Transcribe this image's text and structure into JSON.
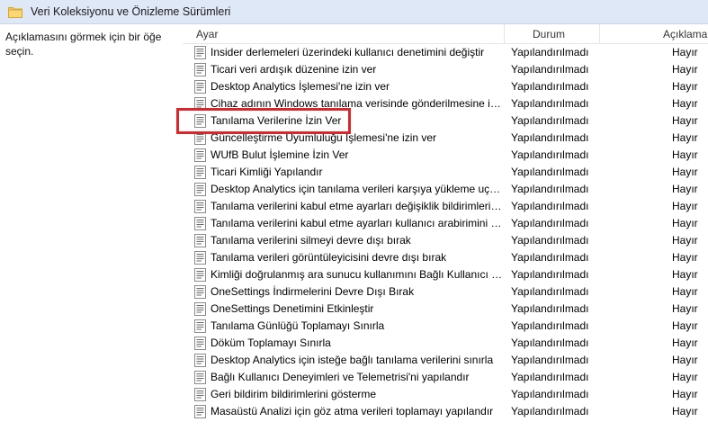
{
  "window": {
    "title": "Veri Koleksiyonu ve Önizleme Sürümleri"
  },
  "description_pane": {
    "text": "Açıklamasını görmek için bir öğe seçin."
  },
  "columns": {
    "name": "Ayar",
    "state": "Durum",
    "comment": "Açıklama"
  },
  "icons": {
    "folder": "folder-icon",
    "policy": "policy-setting-icon"
  },
  "colors": {
    "header_bg": "#dfe8f7",
    "highlight": "#d9262a"
  },
  "rows": [
    {
      "name": "Insider derlemeleri üzerindeki kullanıcı denetimini değiştir",
      "state": "Yapılandırılmadı",
      "comment": "Hayır"
    },
    {
      "name": "Ticari veri ardışık düzenine izin ver",
      "state": "Yapılandırılmadı",
      "comment": "Hayır"
    },
    {
      "name": "Desktop Analytics İşlemesi'ne izin ver",
      "state": "Yapılandırılmadı",
      "comment": "Hayır"
    },
    {
      "name": "Cihaz adının Windows tanılama verisinde gönderilmesine izin ver",
      "state": "Yapılandırılmadı",
      "comment": "Hayır"
    },
    {
      "name": "Tanılama Verilerine İzin Ver",
      "state": "Yapılandırılmadı",
      "comment": "Hayır"
    },
    {
      "name": "Güncelleştirme Uyumluluğu İşlemesi'ne izin ver",
      "state": "Yapılandırılmadı",
      "comment": "Hayır"
    },
    {
      "name": "WUfB Bulut İşlemine İzin Ver",
      "state": "Yapılandırılmadı",
      "comment": "Hayır"
    },
    {
      "name": "Ticari Kimliği Yapılandır",
      "state": "Yapılandırılmadı",
      "comment": "Hayır"
    },
    {
      "name": "Desktop Analytics için tanılama verileri karşıya yükleme uç noktasını yapılandır",
      "state": "Yapılandırılmadı",
      "comment": "Hayır"
    },
    {
      "name": "Tanılama verilerini kabul etme ayarları değişiklik bildirimlerini yapılandır",
      "state": "Yapılandırılmadı",
      "comment": "Hayır"
    },
    {
      "name": "Tanılama verilerini kabul etme ayarları kullanıcı arabirimini yapılandır",
      "state": "Yapılandırılmadı",
      "comment": "Hayır"
    },
    {
      "name": "Tanılama verilerini silmeyi devre dışı bırak",
      "state": "Yapılandırılmadı",
      "comment": "Hayır"
    },
    {
      "name": "Tanılama verileri görüntüleyicisini devre dışı bırak",
      "state": "Yapılandırılmadı",
      "comment": "Hayır"
    },
    {
      "name": "Kimliği doğrulanmış ara sunucu kullanımını Bağlı Kullanıcı Deneyimleri ve Telemetri hizmeti için devre dışı bırak",
      "state": "Yapılandırılmadı",
      "comment": "Hayır"
    },
    {
      "name": "OneSettings İndirmelerini Devre Dışı Bırak",
      "state": "Yapılandırılmadı",
      "comment": "Hayır"
    },
    {
      "name": "OneSettings Denetimini Etkinleştir",
      "state": "Yapılandırılmadı",
      "comment": "Hayır"
    },
    {
      "name": "Tanılama Günlüğü Toplamayı Sınırla",
      "state": "Yapılandırılmadı",
      "comment": "Hayır"
    },
    {
      "name": "Döküm Toplamayı Sınırla",
      "state": "Yapılandırılmadı",
      "comment": "Hayır"
    },
    {
      "name": "Desktop Analytics için isteğe bağlı tanılama verilerini sınırla",
      "state": "Yapılandırılmadı",
      "comment": "Hayır"
    },
    {
      "name": "Bağlı Kullanıcı Deneyimleri ve Telemetrisi'ni yapılandır",
      "state": "Yapılandırılmadı",
      "comment": "Hayır"
    },
    {
      "name": "Geri bildirim bildirimlerini gösterme",
      "state": "Yapılandırılmadı",
      "comment": "Hayır"
    },
    {
      "name": "Masaüstü Analizi için göz atma verileri toplamayı yapılandır",
      "state": "Yapılandırılmadı",
      "comment": "Hayır"
    }
  ]
}
